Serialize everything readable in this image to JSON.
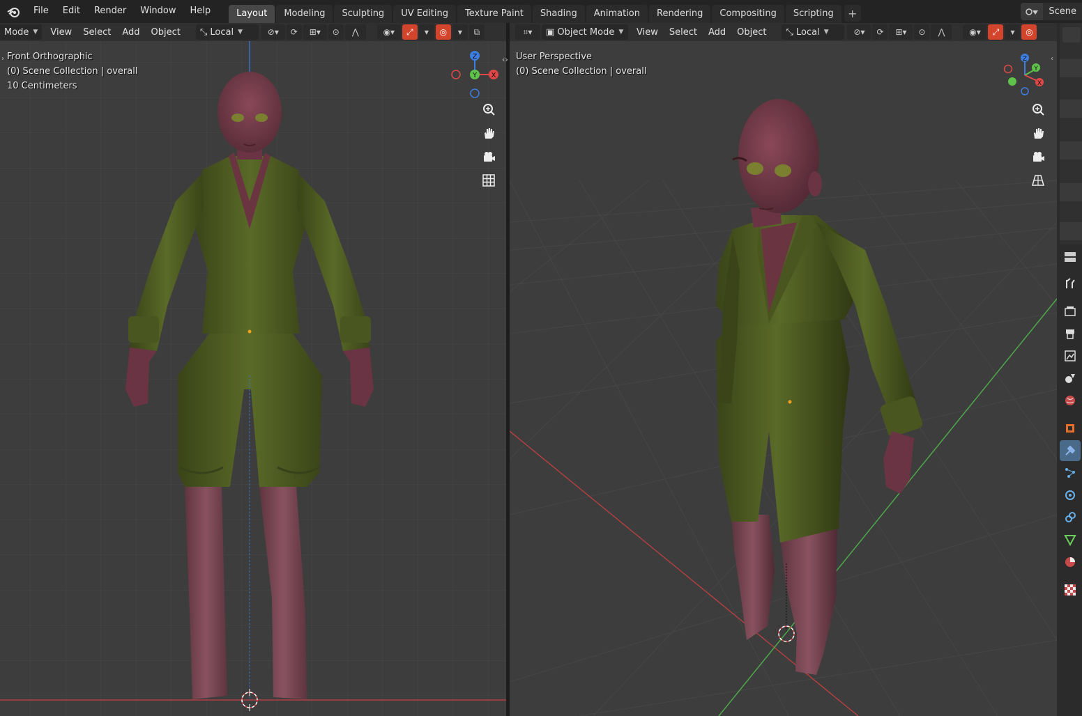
{
  "topbar": {
    "menu": [
      "File",
      "Edit",
      "Render",
      "Window",
      "Help"
    ],
    "tabs": [
      "Layout",
      "Modeling",
      "Sculpting",
      "UV Editing",
      "Texture Paint",
      "Shading",
      "Animation",
      "Rendering",
      "Compositing",
      "Scripting"
    ],
    "active_tab": "Layout",
    "add_tab": "+",
    "scene_label": "Scene"
  },
  "left_header": {
    "mode": "Mode",
    "menus": [
      "View",
      "Select",
      "Add",
      "Object"
    ],
    "orientation": "Local"
  },
  "right_header": {
    "mode": "Object Mode",
    "menus": [
      "View",
      "Select",
      "Add",
      "Object"
    ],
    "orientation": "Local"
  },
  "left_viewport": {
    "line1": "Front Orthographic",
    "line2": "(0) Scene Collection | overall",
    "line3": "10 Centimeters"
  },
  "right_viewport": {
    "line1": "User Perspective",
    "line2": "(0) Scene Collection | overall"
  },
  "gizmo": {
    "x": "X",
    "y": "Y",
    "z": "Z"
  },
  "colors": {
    "x_axis": "#e04848",
    "y_axis": "#5fc24a",
    "z_axis": "#3d7ee0",
    "suit": "#4e5a22",
    "skin": "#7a3e4a",
    "boots": "#7a4450",
    "active_tool": "#d2452c"
  }
}
